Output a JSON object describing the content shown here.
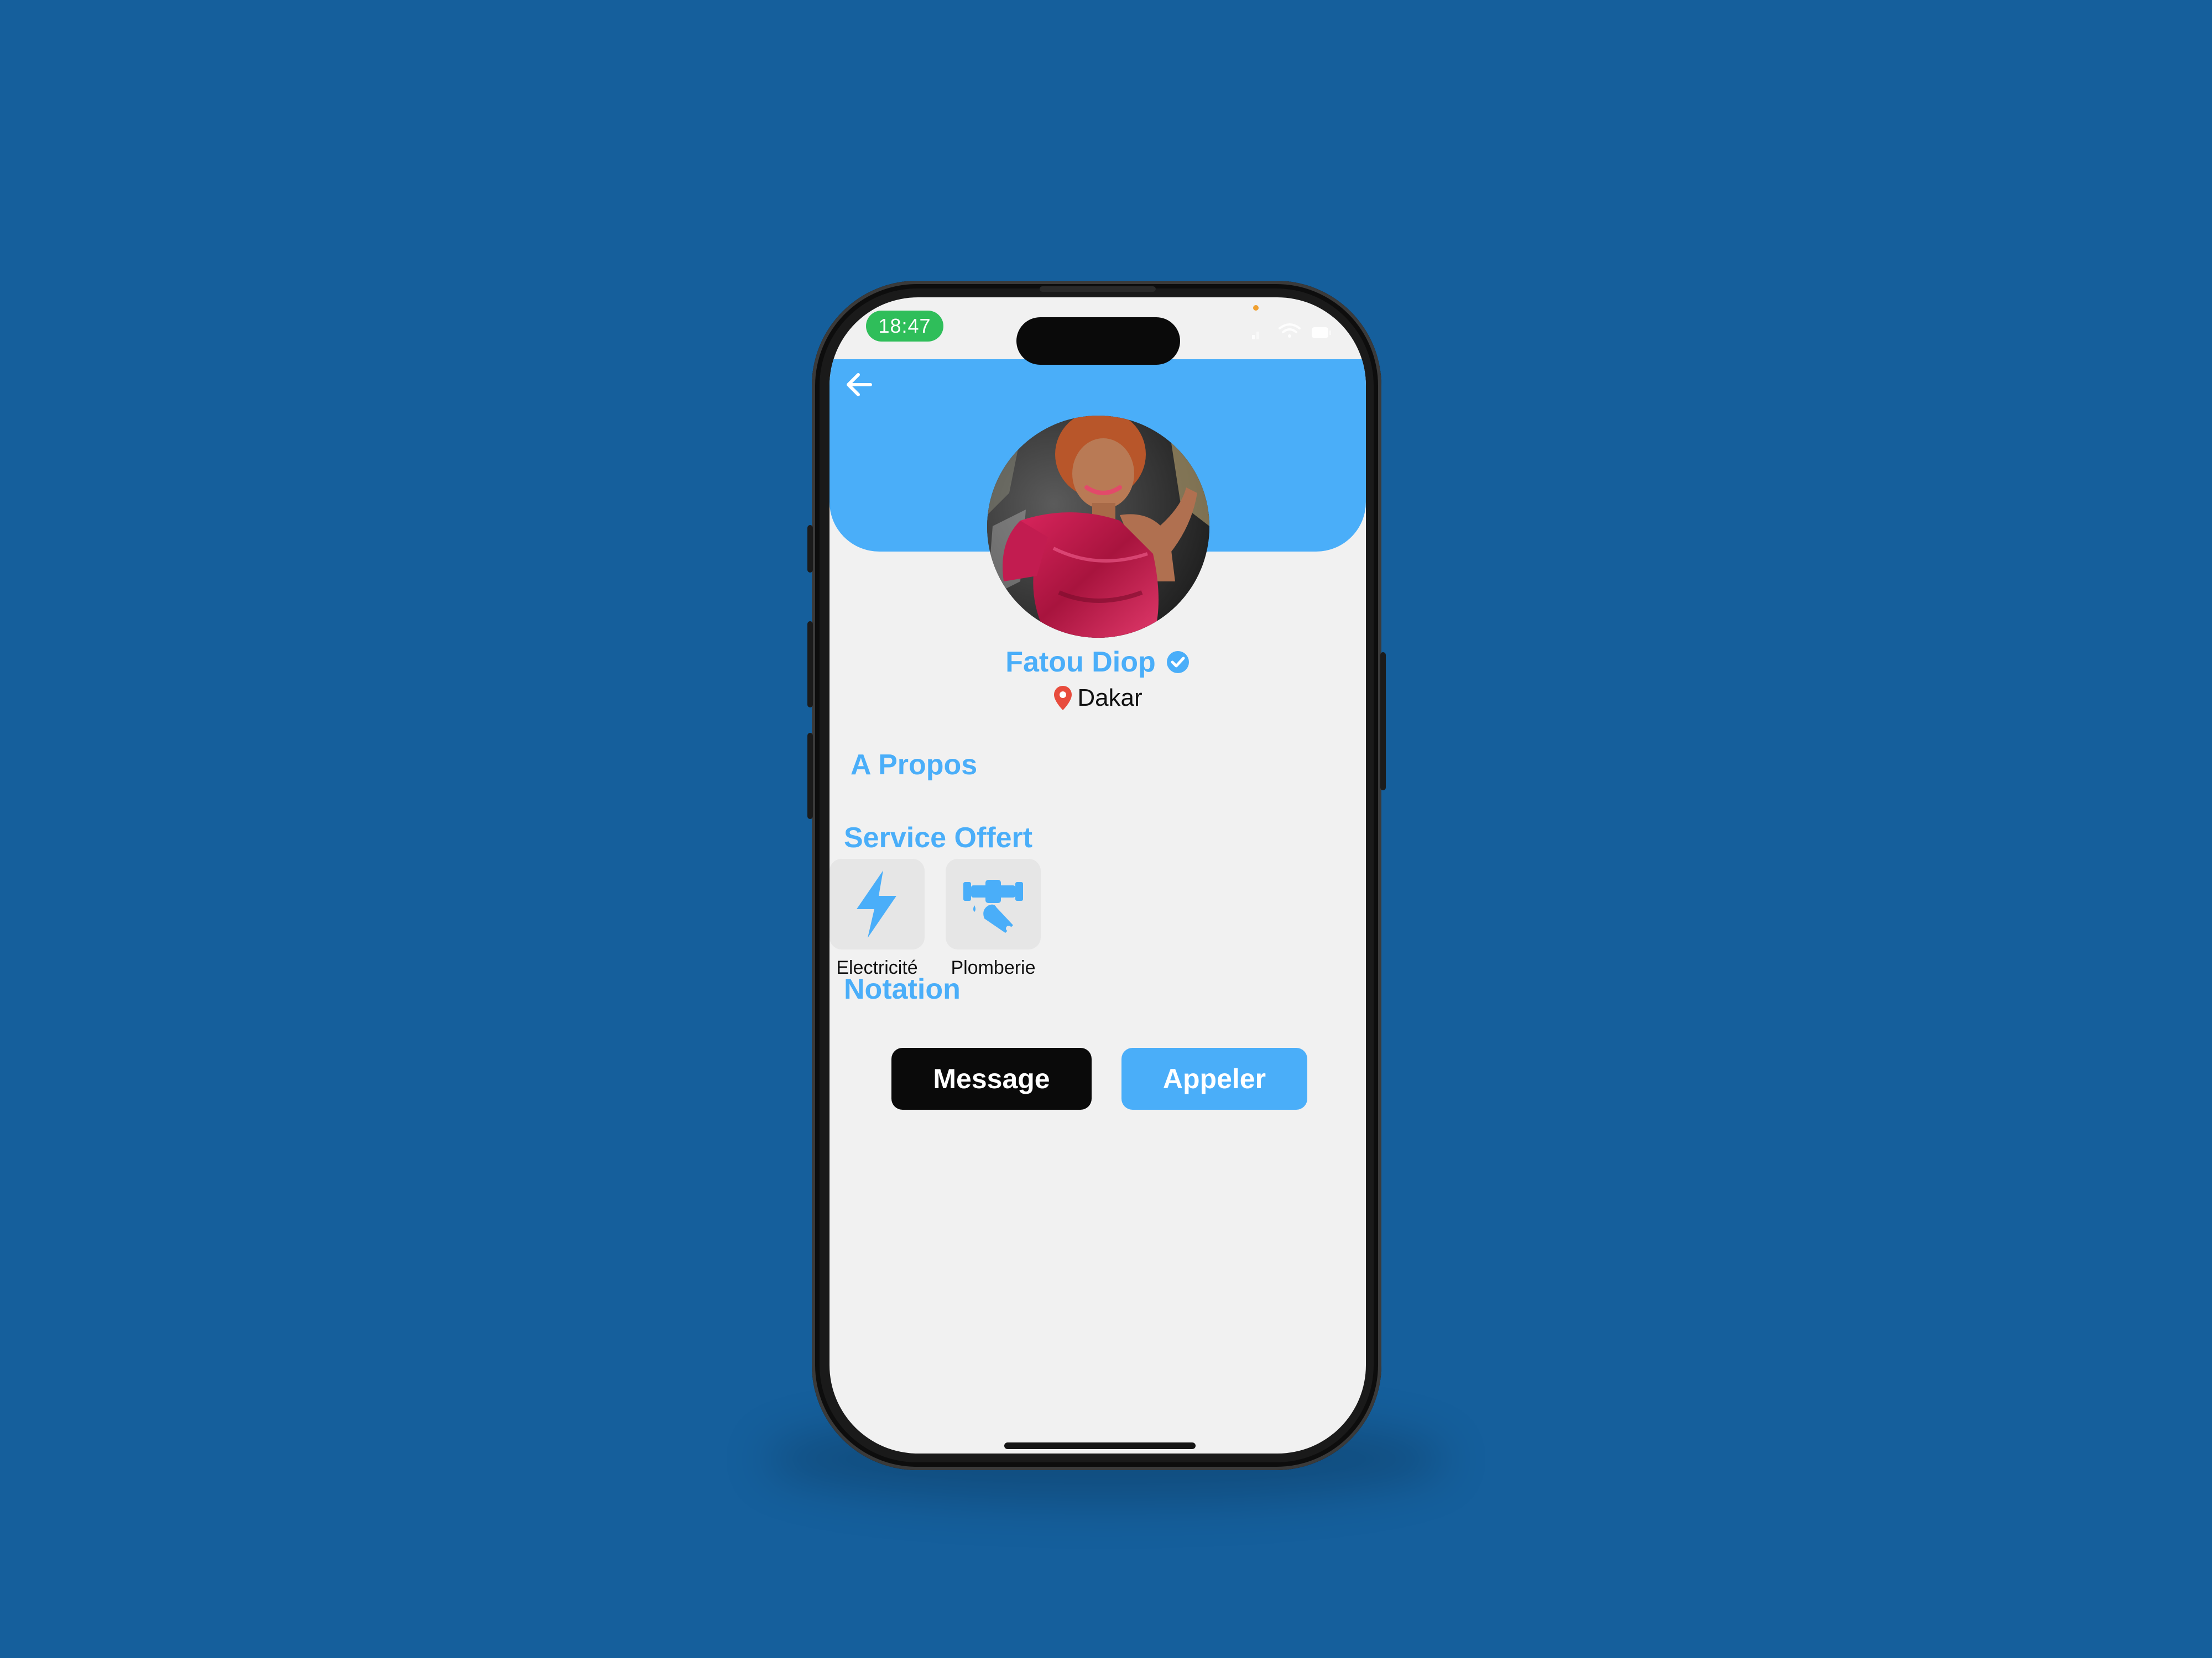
{
  "status_bar": {
    "time": "18:47",
    "icons": [
      "cellular-signal-icon",
      "wifi-icon",
      "battery-icon"
    ]
  },
  "header": {
    "back_icon": "arrow-left-icon",
    "accent_color": "#4aaef9"
  },
  "profile": {
    "name": "Fatou Diop",
    "verified_icon": "verified-check-icon",
    "location_icon": "map-pin-icon",
    "location": "Dakar",
    "avatar_description": "profile-photo"
  },
  "sections": {
    "about_title": "A Propos",
    "services_title": "Service Offert",
    "rating_title": "Notation"
  },
  "services": [
    {
      "label": "Electricité",
      "icon": "lightning-bolt-icon"
    },
    {
      "label": "Plomberie",
      "icon": "plumbing-wrench-icon"
    }
  ],
  "actions": {
    "message_label": "Message",
    "call_label": "Appeler"
  },
  "colors": {
    "background": "#155f9c",
    "accent": "#4aaef9",
    "primary_button": "#0a0a0a",
    "location_pin": "#e84c3d"
  }
}
